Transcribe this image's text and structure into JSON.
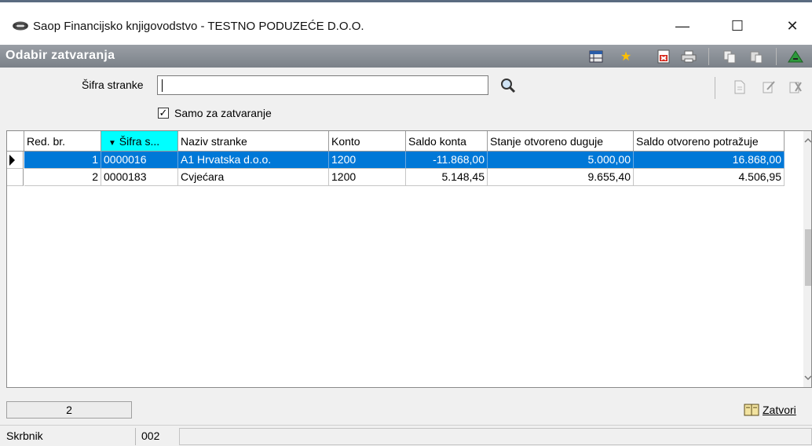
{
  "window": {
    "title": "Saop Financijsko knjigovodstvo - TESTNO PODUZEĆE D.O.O.",
    "minimize": "—",
    "maximize": "☐",
    "close": "✕"
  },
  "header": {
    "title": "Odabir zatvaranja",
    "toolbar_icons": [
      "table-icon",
      "star-icon",
      "export-icon",
      "print-icon",
      "copy-icon",
      "paste-icon",
      "exit-icon"
    ]
  },
  "filter": {
    "partner_code_label": "Šifra stranke",
    "partner_code_value": "",
    "only_closing_checked": true,
    "only_closing_label": "Samo za zatvaranje",
    "checkmark": "✓",
    "action_icons": [
      "new-document-icon",
      "edit-icon",
      "delete-icon"
    ]
  },
  "grid": {
    "columns": [
      "Red. br.",
      "Šifra s...",
      "Naziv stranke",
      "Konto",
      "Saldo konta",
      "Stanje otvoreno duguje",
      "Saldo otvoreno potražuje"
    ],
    "rows": [
      {
        "red_br": "1",
        "sifra": "0000016",
        "naziv": "A1 Hrvatska d.o.o.",
        "konto": "1200",
        "saldo": "-11.868,00",
        "duguje": "5.000,00",
        "potrazuje": "16.868,00",
        "selected": true
      },
      {
        "red_br": "2",
        "sifra": "0000183",
        "naziv": "Cvjećara",
        "konto": "1200",
        "saldo": "5.148,45",
        "duguje": "9.655,40",
        "potrazuje": "4.506,95",
        "selected": false
      }
    ]
  },
  "footer": {
    "row_count": "2",
    "close_label": "Zatvori"
  },
  "status": {
    "user_label": "Skrbnik",
    "user_code": "002"
  },
  "colors": {
    "selection": "#0078d7",
    "sorted_header": "#00ffff",
    "header_bar": "#8a8f96"
  }
}
